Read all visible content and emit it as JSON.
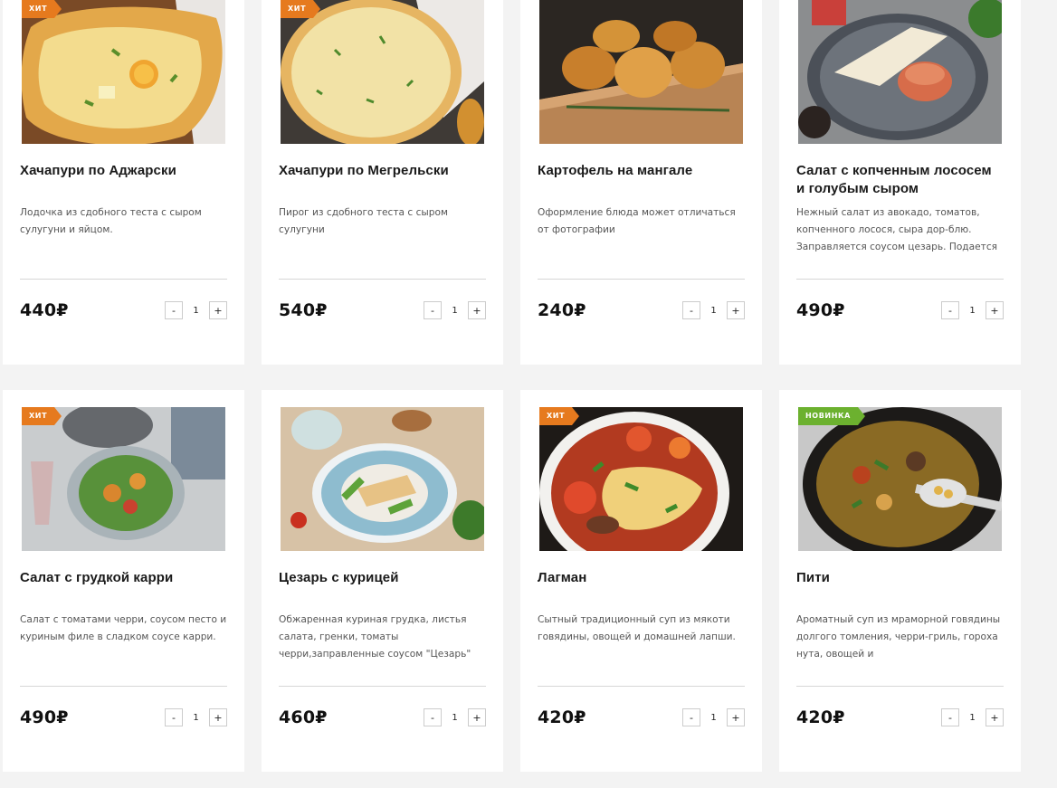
{
  "currency": "₽",
  "badge_colors": {
    "hit": "#e67a1e",
    "new": "#6cb12f"
  },
  "products": [
    {
      "title": "Хачапури по Аджарски",
      "desc": "Лодочка из сдобного теста с сыром сулугуни и яйцом.",
      "price": "440₽",
      "qty": "1",
      "badge": "ХИТ",
      "badge_type": "hit",
      "image_icon": "khachapuri-adjarian-photo"
    },
    {
      "title": "Хачапури по Мегрельски",
      "desc": "Пирог из сдобного теста с сыром сулугуни",
      "price": "540₽",
      "qty": "1",
      "badge": "ХИТ",
      "badge_type": "hit",
      "image_icon": "khachapuri-megrelian-photo"
    },
    {
      "title": "Картофель на мангале",
      "desc": "Оформление блюда может отличаться от фотографии",
      "price": "240₽",
      "qty": "1",
      "badge": "",
      "badge_type": "",
      "image_icon": "grilled-potatoes-photo"
    },
    {
      "title": "Салат с копченным лососем и голубым сыром",
      "desc": "Нежный салат из авокадо, томатов, копченного лосося, сыра дор-блю. Заправляется соусом цезарь. Подается",
      "price": "490₽",
      "qty": "1",
      "badge": "",
      "badge_type": "",
      "image_icon": "salmon-salad-photo"
    },
    {
      "title": "Салат с грудкой карри",
      "desc": "Салат с томатами черри, соусом песто и куриным филе в сладком соусе карри.",
      "price": "490₽",
      "qty": "1",
      "badge": "ХИТ",
      "badge_type": "hit",
      "image_icon": "curry-chicken-salad-photo"
    },
    {
      "title": "Цезарь с курицей",
      "desc": "Обжаренная куриная грудка, листья салата, гренки, томаты черри,заправленные соусом \"Цезарь\"",
      "price": "460₽",
      "qty": "1",
      "badge": "",
      "badge_type": "",
      "image_icon": "caesar-salad-photo"
    },
    {
      "title": "Лагман",
      "desc": "Сытный традиционный суп из мякоти говядины, овощей и домашней лапши.",
      "price": "420₽",
      "qty": "1",
      "badge": "ХИТ",
      "badge_type": "hit",
      "image_icon": "lagman-soup-photo"
    },
    {
      "title": "Пити",
      "desc": "Ароматный суп из мраморной говядины долгого томления, черри-гриль, гороха нута, овощей и",
      "price": "420₽",
      "qty": "1",
      "badge": "НОВИНКА",
      "badge_type": "new",
      "image_icon": "piti-soup-photo"
    }
  ],
  "qty_controls": {
    "minus": "-",
    "plus": "+"
  }
}
